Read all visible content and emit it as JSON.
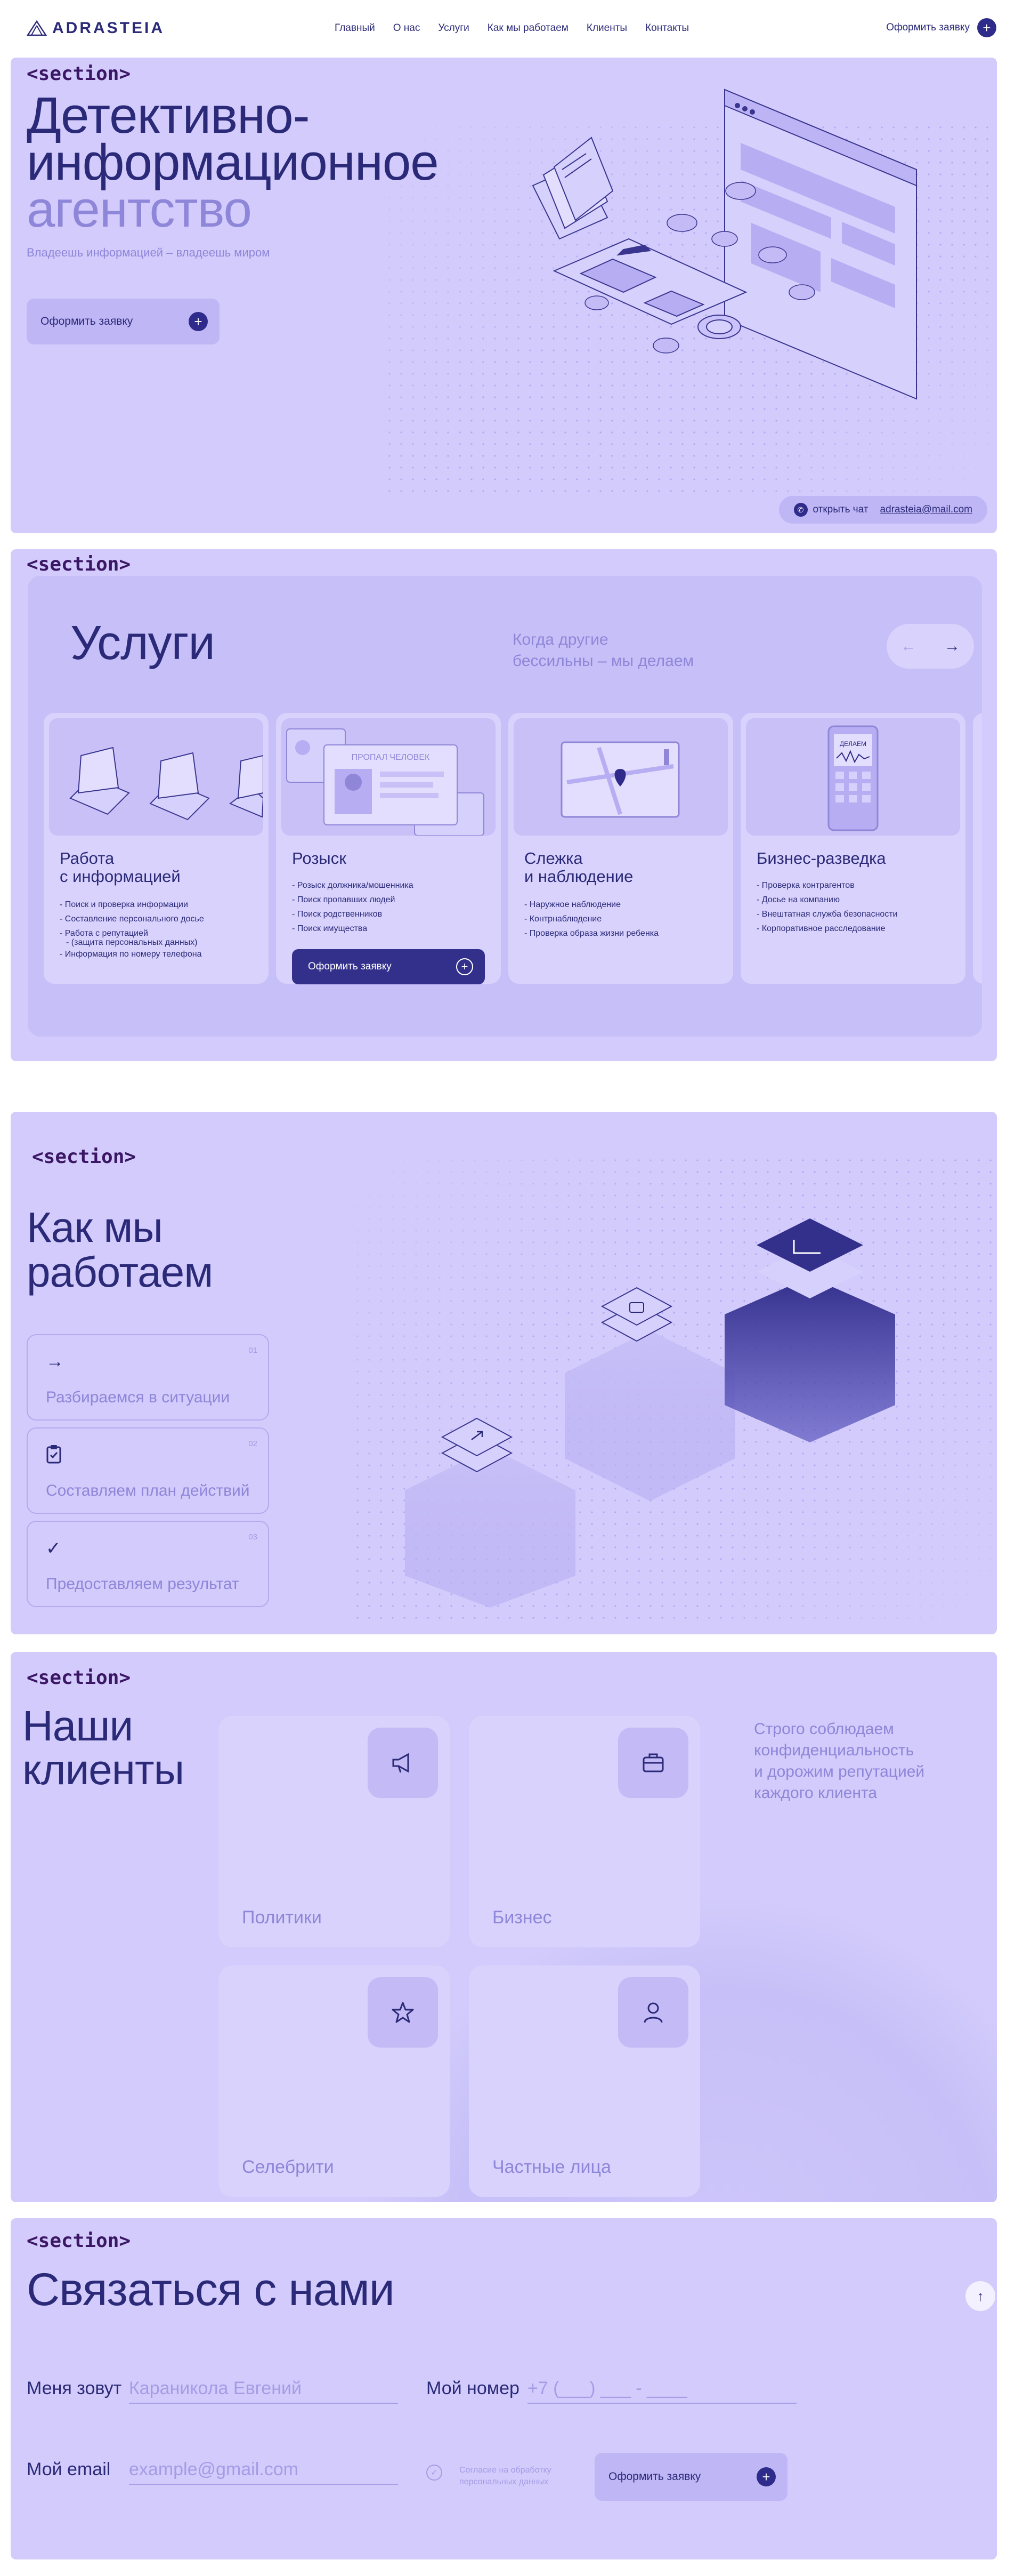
{
  "header": {
    "logo": "ADRASTEIA",
    "nav": [
      "Главный",
      "О нас",
      "Услуги",
      "Как мы работаем",
      "Клиенты",
      "Контакты"
    ],
    "cta": "Оформить заявку"
  },
  "hero": {
    "tag": "<section>",
    "title_line1": "Детективно-",
    "title_line2": "информационное",
    "title_line3": "агентство",
    "subtitle": "Владеешь информацией – владеешь миром",
    "button": "Оформить заявку",
    "chat": "открыть чат",
    "email": "adrasteia@mail.com"
  },
  "services": {
    "tag": "<section>",
    "title": "Услуги",
    "note_line1": "Когда другие",
    "note_line2": "бессильны – мы делаем",
    "cards": [
      {
        "title_line1": "Работа",
        "title_line2": "с информацией",
        "items": [
          "Поиск и проверка информации",
          "Составление персонального досье",
          "Работа с репутацией",
          "(защита персональных данных)",
          "Информация по номеру телефона"
        ]
      },
      {
        "title_line1": "Розыск",
        "title_line2": "",
        "items": [
          "Розыск должника/мошенника",
          "Поиск пропавших людей",
          "Поиск родственников",
          "Поиск имущества"
        ],
        "button": "Оформить заявку",
        "image_text": "ПРОПАЛ ЧЕЛОВЕК"
      },
      {
        "title_line1": "Слежка",
        "title_line2": "и наблюдение",
        "items": [
          "Наружное наблюдение",
          "Контрнаблюдение",
          "Проверка образа жизни ребенка"
        ]
      },
      {
        "title_line1": "Бизнес-разведка",
        "title_line2": "",
        "items": [
          "Проверка контрагентов",
          "Досье на компанию",
          "Внештатная служба безопасности",
          "Корпоративное расследование"
        ],
        "image_text": "ДЕЛАЕМ"
      }
    ]
  },
  "how": {
    "tag": "<section>",
    "title_line1": "Как мы",
    "title_line2": "работаем",
    "steps": [
      {
        "num": "01",
        "text": "Разбираемся в ситуации",
        "icon": "arrow-right-icon"
      },
      {
        "num": "02",
        "text": "Составляем план действий",
        "icon": "clipboard-icon"
      },
      {
        "num": "03",
        "text": "Предоставляем результат",
        "icon": "check-icon"
      }
    ]
  },
  "clients": {
    "tag": "<section>",
    "title_line1": "Наши",
    "title_line2": "клиенты",
    "note_line1": "Строго соблюдаем",
    "note_line2": "конфиденциальность",
    "note_line3": "и дорожим репутацией",
    "note_line4": "каждого клиента",
    "cards": [
      {
        "label": "Политики",
        "icon": "megaphone-icon"
      },
      {
        "label": "Бизнес",
        "icon": "briefcase-icon"
      },
      {
        "label": "Селебрити",
        "icon": "star-icon"
      },
      {
        "label": "Частные лица",
        "icon": "person-icon"
      }
    ]
  },
  "contact": {
    "tag": "<section>",
    "title": "Связаться с нами",
    "name_label": "Меня зовут",
    "name_placeholder": "Караникола Евгений",
    "phone_label": "Мой номер",
    "phone_placeholder": "+7 (___) ___ - ____",
    "email_label": "Мой email",
    "email_placeholder": "example@gmail.com",
    "consent_line1": "Согласие на обработку",
    "consent_line2": "персональных данных",
    "button": "Оформить заявку"
  },
  "colors": {
    "panel": "#d2cbfb",
    "accent": "#2f2b8a",
    "muted_text": "#8e86d8",
    "tag": "#3a1664"
  }
}
